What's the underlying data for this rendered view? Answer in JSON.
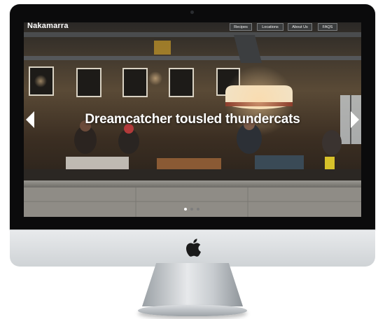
{
  "site": {
    "brand": "Nakamarra"
  },
  "nav": {
    "items": [
      "Recipes",
      "Locations",
      "About Us",
      "FAQS"
    ]
  },
  "hero": {
    "caption": "Dreamcatcher tousled thundercats"
  },
  "carousel": {
    "slide_count": 3,
    "active_index": 0
  },
  "colors": {
    "nav_button": "#3a3c3d",
    "dot_active": "#ffffff",
    "dot_inactive": "#7d7d7d"
  },
  "icons": {
    "prev": "chevron-left-icon",
    "next": "chevron-right-icon",
    "brand_logo": "apple-logo-icon"
  }
}
